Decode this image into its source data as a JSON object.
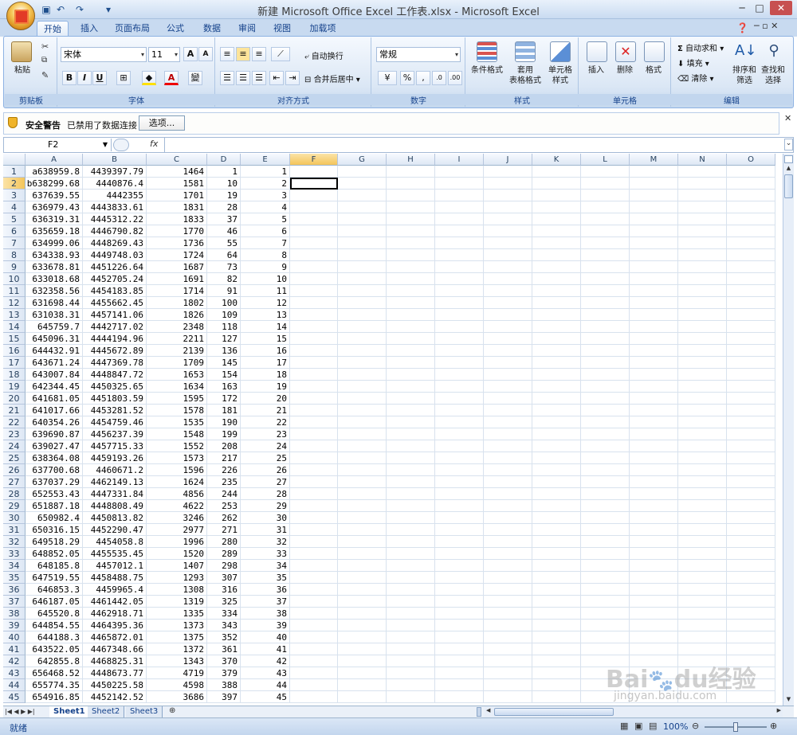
{
  "title": "新建 Microsoft Office Excel 工作表.xlsx - Microsoft Excel",
  "quick_access": [
    "save-icon",
    "undo-icon",
    "redo-icon",
    "customize-icon"
  ],
  "tabs": [
    "开始",
    "插入",
    "页面布局",
    "公式",
    "数据",
    "审阅",
    "视图",
    "加载项"
  ],
  "ribbon": {
    "clipboard": {
      "label": "剪贴板",
      "paste": "粘贴"
    },
    "font": {
      "label": "字体",
      "name": "宋体",
      "size": "11"
    },
    "alignment": {
      "label": "对齐方式",
      "wrap": "自动换行",
      "merge": "合并后居中"
    },
    "number": {
      "label": "数字",
      "format": "常规"
    },
    "styles": {
      "label": "样式",
      "cond": "条件格式",
      "table": "套用\n表格格式",
      "cell": "单元格\n样式"
    },
    "cells": {
      "label": "单元格",
      "insert": "插入",
      "delete": "删除",
      "format": "格式"
    },
    "editing": {
      "label": "编辑",
      "autosum": "自动求和",
      "fill": "填充",
      "clear": "清除",
      "sort": "排序和\n筛选",
      "find": "查找和\n选择"
    }
  },
  "security": {
    "title": "安全警告",
    "message": "已禁用了数据连接",
    "options": "选项..."
  },
  "formula_bar": {
    "name_box": "F2",
    "fx": "fx",
    "value": ""
  },
  "columns": [
    "A",
    "B",
    "C",
    "D",
    "E",
    "F",
    "G",
    "H",
    "I",
    "J",
    "K",
    "L",
    "M",
    "N",
    "O"
  ],
  "rows": [
    [
      "a638959.8",
      "4439397.79",
      "1464",
      "1",
      "1"
    ],
    [
      "b638299.68",
      "4440876.4",
      "1581",
      "10",
      "2"
    ],
    [
      "637639.55",
      "4442355",
      "1701",
      "19",
      "3"
    ],
    [
      "636979.43",
      "4443833.61",
      "1831",
      "28",
      "4"
    ],
    [
      "636319.31",
      "4445312.22",
      "1833",
      "37",
      "5"
    ],
    [
      "635659.18",
      "4446790.82",
      "1770",
      "46",
      "6"
    ],
    [
      "634999.06",
      "4448269.43",
      "1736",
      "55",
      "7"
    ],
    [
      "634338.93",
      "4449748.03",
      "1724",
      "64",
      "8"
    ],
    [
      "633678.81",
      "4451226.64",
      "1687",
      "73",
      "9"
    ],
    [
      "633018.68",
      "4452705.24",
      "1691",
      "82",
      "10"
    ],
    [
      "632358.56",
      "4454183.85",
      "1714",
      "91",
      "11"
    ],
    [
      "631698.44",
      "4455662.45",
      "1802",
      "100",
      "12"
    ],
    [
      "631038.31",
      "4457141.06",
      "1826",
      "109",
      "13"
    ],
    [
      "645759.7",
      "4442717.02",
      "2348",
      "118",
      "14"
    ],
    [
      "645096.31",
      "4444194.96",
      "2211",
      "127",
      "15"
    ],
    [
      "644432.91",
      "4445672.89",
      "2139",
      "136",
      "16"
    ],
    [
      "643671.24",
      "4447369.78",
      "1709",
      "145",
      "17"
    ],
    [
      "643007.84",
      "4448847.72",
      "1653",
      "154",
      "18"
    ],
    [
      "642344.45",
      "4450325.65",
      "1634",
      "163",
      "19"
    ],
    [
      "641681.05",
      "4451803.59",
      "1595",
      "172",
      "20"
    ],
    [
      "641017.66",
      "4453281.52",
      "1578",
      "181",
      "21"
    ],
    [
      "640354.26",
      "4454759.46",
      "1535",
      "190",
      "22"
    ],
    [
      "639690.87",
      "4456237.39",
      "1548",
      "199",
      "23"
    ],
    [
      "639027.47",
      "4457715.33",
      "1552",
      "208",
      "24"
    ],
    [
      "638364.08",
      "4459193.26",
      "1573",
      "217",
      "25"
    ],
    [
      "637700.68",
      "4460671.2",
      "1596",
      "226",
      "26"
    ],
    [
      "637037.29",
      "4462149.13",
      "1624",
      "235",
      "27"
    ],
    [
      "652553.43",
      "4447331.84",
      "4856",
      "244",
      "28"
    ],
    [
      "651887.18",
      "4448808.49",
      "4622",
      "253",
      "29"
    ],
    [
      "650982.4",
      "4450813.82",
      "3246",
      "262",
      "30"
    ],
    [
      "650316.15",
      "4452290.47",
      "2977",
      "271",
      "31"
    ],
    [
      "649518.29",
      "4454058.8",
      "1996",
      "280",
      "32"
    ],
    [
      "648852.05",
      "4455535.45",
      "1520",
      "289",
      "33"
    ],
    [
      "648185.8",
      "4457012.1",
      "1407",
      "298",
      "34"
    ],
    [
      "647519.55",
      "4458488.75",
      "1293",
      "307",
      "35"
    ],
    [
      "646853.3",
      "4459965.4",
      "1308",
      "316",
      "36"
    ],
    [
      "646187.05",
      "4461442.05",
      "1319",
      "325",
      "37"
    ],
    [
      "645520.8",
      "4462918.71",
      "1335",
      "334",
      "38"
    ],
    [
      "644854.55",
      "4464395.36",
      "1373",
      "343",
      "39"
    ],
    [
      "644188.3",
      "4465872.01",
      "1375",
      "352",
      "40"
    ],
    [
      "643522.05",
      "4467348.66",
      "1372",
      "361",
      "41"
    ],
    [
      "642855.8",
      "4468825.31",
      "1343",
      "370",
      "42"
    ],
    [
      "656468.52",
      "4448673.77",
      "4719",
      "379",
      "43"
    ],
    [
      "655774.35",
      "4450225.58",
      "4598",
      "388",
      "44"
    ],
    [
      "654916.85",
      "4452142.52",
      "3686",
      "397",
      "45"
    ]
  ],
  "sheets": [
    "Sheet1",
    "Sheet2",
    "Sheet3"
  ],
  "status": {
    "ready": "就绪",
    "zoom": "100%"
  },
  "watermark": "Baidu经验 jingyan.baidu.com"
}
